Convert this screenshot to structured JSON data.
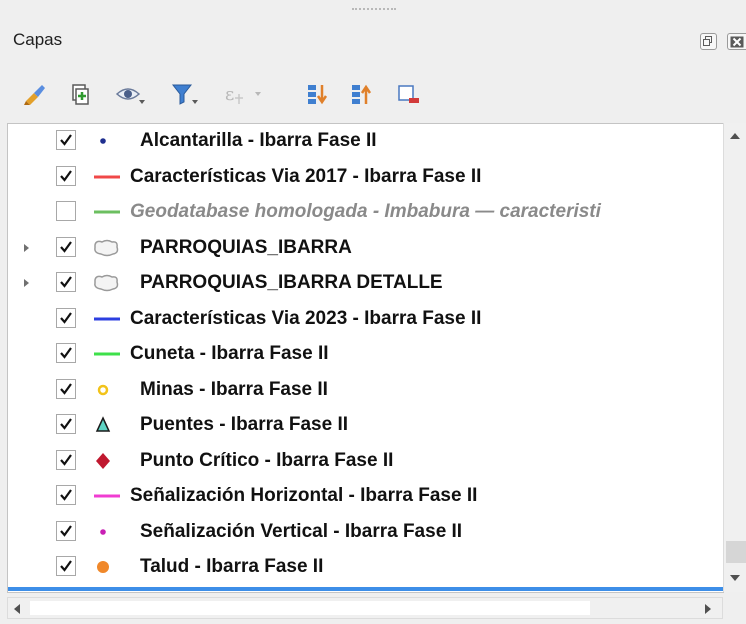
{
  "panel": {
    "title": "Capas"
  },
  "toolbar": {
    "buttons": [
      {
        "icon": "style-brush-icon"
      },
      {
        "icon": "add-group-icon"
      },
      {
        "icon": "visibility-eye-icon"
      },
      {
        "icon": "filter-legend-icon"
      },
      {
        "icon": "filter-expression-icon"
      },
      {
        "icon": "expand-all-icon"
      },
      {
        "icon": "collapse-all-icon"
      },
      {
        "icon": "remove-layer-icon"
      }
    ]
  },
  "layers": [
    {
      "label": "Alcantarilla - Ibarra Fase II",
      "checked": true,
      "symbol": "dot",
      "color": "#1f2f8f",
      "expandable": false
    },
    {
      "label": "Características Via 2017 - Ibarra Fase II",
      "checked": true,
      "symbol": "line",
      "color": "#f04848",
      "expandable": false
    },
    {
      "label": "Geodatabase homologada - Imbabura — caracteristi",
      "checked": false,
      "symbol": "line",
      "color": "#6cbf60",
      "expandable": false
    },
    {
      "label": "PARROQUIAS_IBARRA",
      "checked": true,
      "symbol": "polygon",
      "color": "#d0d0d0",
      "expandable": true
    },
    {
      "label": "PARROQUIAS_IBARRA DETALLE",
      "checked": true,
      "symbol": "polygon",
      "color": "#d0d0d0",
      "expandable": true
    },
    {
      "label": "Características Via 2023 - Ibarra Fase II",
      "checked": true,
      "symbol": "line",
      "color": "#2c3fe0",
      "expandable": false
    },
    {
      "label": "Cuneta - Ibarra Fase II",
      "checked": true,
      "symbol": "line",
      "color": "#3ee04a",
      "expandable": false
    },
    {
      "label": "Minas - Ibarra Fase II",
      "checked": true,
      "symbol": "circle-outline",
      "color": "#f2c31a",
      "expandable": false
    },
    {
      "label": "Puentes - Ibarra Fase II",
      "checked": true,
      "symbol": "triangle",
      "color": "#5ed4c4",
      "expandable": false
    },
    {
      "label": "Punto Crítico - Ibarra Fase II",
      "checked": true,
      "symbol": "diamond",
      "color": "#c0182f",
      "expandable": false
    },
    {
      "label": "Señalización Horizontal - Ibarra Fase II",
      "checked": true,
      "symbol": "line",
      "color": "#f03cd2",
      "expandable": false
    },
    {
      "label": "Señalización Vertical - Ibarra Fase II",
      "checked": true,
      "symbol": "dot",
      "color": "#c81fb4",
      "expandable": false
    },
    {
      "label": "Talud - Ibarra Fase II",
      "checked": true,
      "symbol": "circle",
      "color": "#f0882a",
      "expandable": false
    }
  ]
}
